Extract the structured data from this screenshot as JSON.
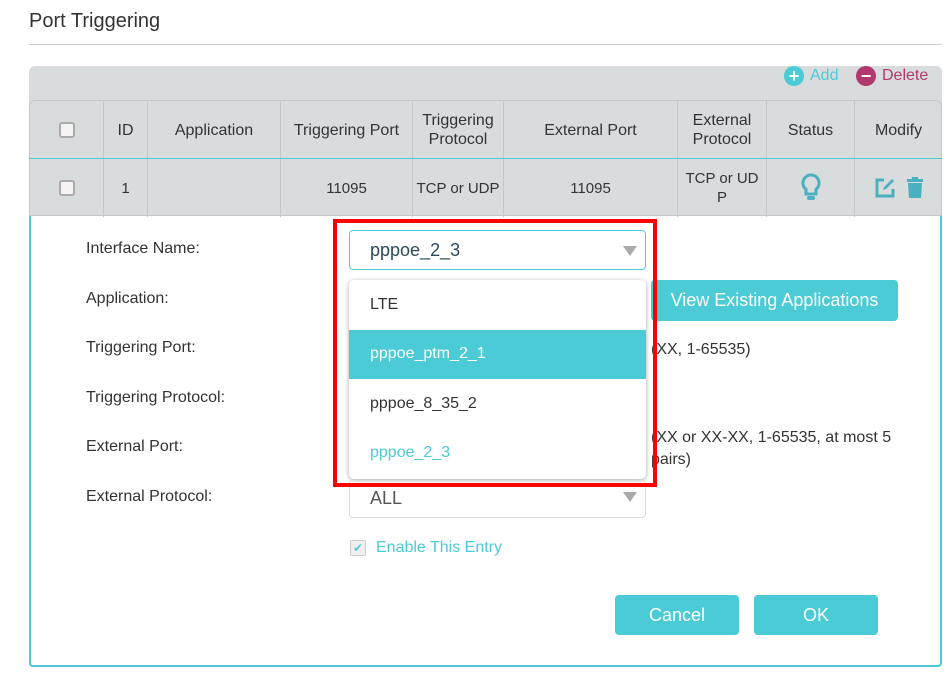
{
  "page": {
    "title": "Port Triggering"
  },
  "toolbar": {
    "add_label": "Add",
    "delete_label": "Delete"
  },
  "colors": {
    "accent": "#4acbd6",
    "delete": "#b5376f",
    "highlight_box": "#ff0000"
  },
  "table": {
    "headers": [
      "",
      "ID",
      "Application",
      "Triggering Port",
      "Triggering Protocol",
      "External Port",
      "External Protocol",
      "Status",
      "Modify"
    ],
    "rows": [
      {
        "id": "1",
        "application": "",
        "triggering_port": "11095",
        "triggering_protocol": "TCP or UDP",
        "external_port": "11095",
        "external_protocol": "TCP or UDP",
        "status_icon": "lightbulb-icon",
        "modify_icons": [
          "edit-icon",
          "trash-icon"
        ]
      }
    ]
  },
  "form": {
    "labels": {
      "interface": "Interface Name:",
      "application": "Application:",
      "triggering_port": "Triggering Port:",
      "triggering_protocol": "Triggering Protocol:",
      "external_port": "External Port:",
      "external_protocol": "External Protocol:"
    },
    "interface_value": "pppoe_2_3",
    "interface_options": [
      "LTE",
      "pppoe_ptm_2_1",
      "pppoe_8_35_2",
      "pppoe_2_3"
    ],
    "view_apps_label": "View Existing Applications",
    "triggering_port_hint": "(XX, 1-65535)",
    "external_port_hint": "(XX or XX-XX, 1-65535, at most 5 pairs)",
    "external_protocol_value": "ALL",
    "enable_label": "Enable This Entry",
    "enable_checked": true,
    "cancel_label": "Cancel",
    "ok_label": "OK"
  }
}
